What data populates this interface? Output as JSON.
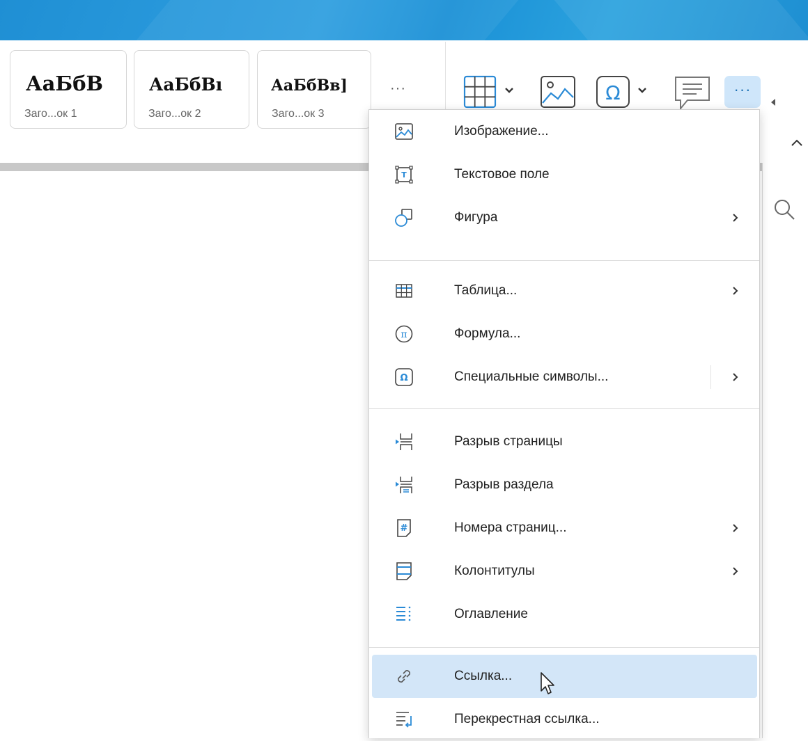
{
  "styles": [
    {
      "sample": "АаБбВ",
      "name": "Заго...ок 1"
    },
    {
      "sample": "АаБбВı",
      "name": "Заго...ок 2"
    },
    {
      "sample": "АаБбВв]",
      "name": "Заго...ок 3"
    }
  ],
  "toolbar": {
    "more_styles": "···",
    "more_tools": "···",
    "tools": [
      "table-icon",
      "image-icon",
      "omega-icon",
      "comment-icon",
      "more-icon"
    ]
  },
  "menu": {
    "items": [
      {
        "label": "Изображение...",
        "icon": "image-icon",
        "submenu": false
      },
      {
        "label": "Текстовое поле",
        "icon": "textbox-icon",
        "submenu": false
      },
      {
        "label": "Фигура",
        "icon": "shapes-icon",
        "submenu": true
      },
      {
        "label": "Таблица...",
        "icon": "table-icon",
        "submenu": true
      },
      {
        "label": "Формула...",
        "icon": "formula-icon",
        "submenu": false
      },
      {
        "label": "Специальные символы...",
        "icon": "omega-icon",
        "submenu": true
      },
      {
        "label": "Разрыв страницы",
        "icon": "page-break-icon",
        "submenu": false
      },
      {
        "label": "Разрыв раздела",
        "icon": "section-break-icon",
        "submenu": false
      },
      {
        "label": "Номера страниц...",
        "icon": "page-numbers-icon",
        "submenu": true
      },
      {
        "label": "Колонтитулы",
        "icon": "header-footer-icon",
        "submenu": true
      },
      {
        "label": "Оглавление",
        "icon": "toc-icon",
        "submenu": false
      },
      {
        "label": "Ссылка...",
        "icon": "link-icon",
        "submenu": false,
        "active": true
      },
      {
        "label": "Перекрестная ссылка...",
        "icon": "cross-reference-icon",
        "submenu": false
      }
    ]
  },
  "colors": {
    "accent": "#1a90d6",
    "highlight": "#d3e6f8",
    "icon_blue": "#2a8ad6"
  }
}
